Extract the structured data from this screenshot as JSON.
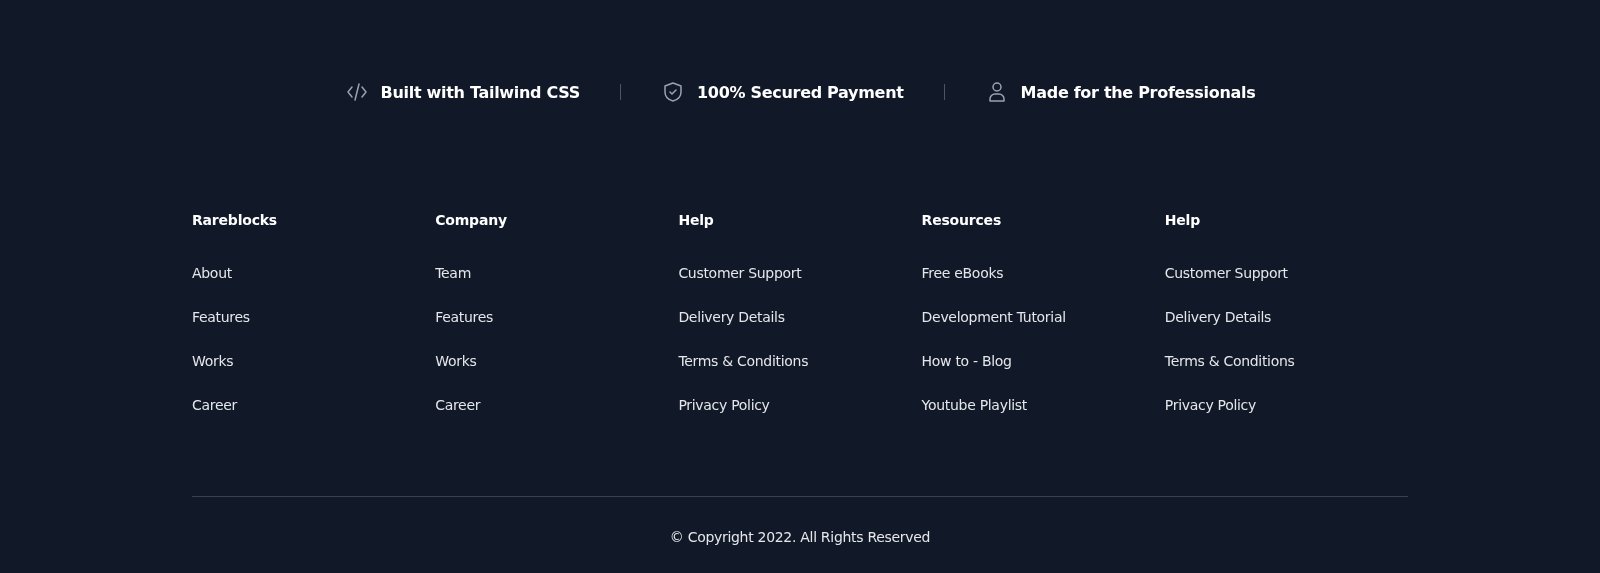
{
  "features": [
    {
      "kind": "code",
      "label": "Built with Tailwind CSS"
    },
    {
      "kind": "shield",
      "label": "100% Secured Payment"
    },
    {
      "kind": "user",
      "label": "Made for the Professionals"
    }
  ],
  "columns": [
    {
      "heading": "Rareblocks",
      "links": [
        "About",
        "Features",
        "Works",
        "Career"
      ]
    },
    {
      "heading": "Company",
      "links": [
        "Team",
        "Features",
        "Works",
        "Career"
      ]
    },
    {
      "heading": "Help",
      "links": [
        "Customer Support",
        "Delivery Details",
        "Terms & Conditions",
        "Privacy Policy"
      ]
    },
    {
      "heading": "Resources",
      "links": [
        "Free eBooks",
        "Development Tutorial",
        "How to - Blog",
        "Youtube Playlist"
      ]
    },
    {
      "heading": "Help",
      "links": [
        "Customer Support",
        "Delivery Details",
        "Terms & Conditions",
        "Privacy Policy"
      ]
    }
  ],
  "copyright": "© Copyright 2022. All Rights Reserved"
}
